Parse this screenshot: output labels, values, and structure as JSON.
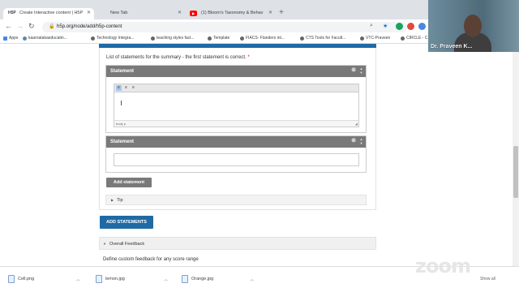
{
  "browser": {
    "tabs": [
      {
        "label": "Create Interactive content | H5P",
        "favicon": "H5P",
        "active": true
      },
      {
        "label": "New Tab",
        "favicon": "",
        "active": false
      },
      {
        "label": "(1) Bloom's Taxonomy & Behav",
        "favicon": "youtube",
        "active": false
      }
    ],
    "url": "h5p.org/node/add/h5p-content",
    "bookmarks": [
      "Apps",
      "kaarnatakaeducatin...",
      "Technology Integra...",
      "teaching styles fact...",
      "Template",
      "FIACS- Flanders int...",
      "CTS Tools for Facult...",
      "VTC-Praveen",
      "CIRCLE - C"
    ]
  },
  "editor": {
    "instruction": "List of statements for the summary - the first statement is correct.",
    "required_marker": "*",
    "statements": [
      {
        "header": "Statement",
        "footer_path": "body  p"
      },
      {
        "header": "Statement"
      }
    ],
    "add_statement_label": "Add statement",
    "tip_label": "Tip",
    "add_statements_label": "ADD STATEMENTS",
    "overall_feedback_label": "Overall Feedback",
    "custom_feedback_text": "Define custom feedback for any score range"
  },
  "downloads": {
    "items": [
      "Cell.png",
      "lemon.jpg",
      "Orange.jpg"
    ],
    "show_all": "Show all"
  },
  "video": {
    "participant_name": "Dr. Praveen K..."
  },
  "watermark": "zoom",
  "colors": {
    "h5p_blue": "#1f6aa5",
    "group_header": "#797979"
  }
}
